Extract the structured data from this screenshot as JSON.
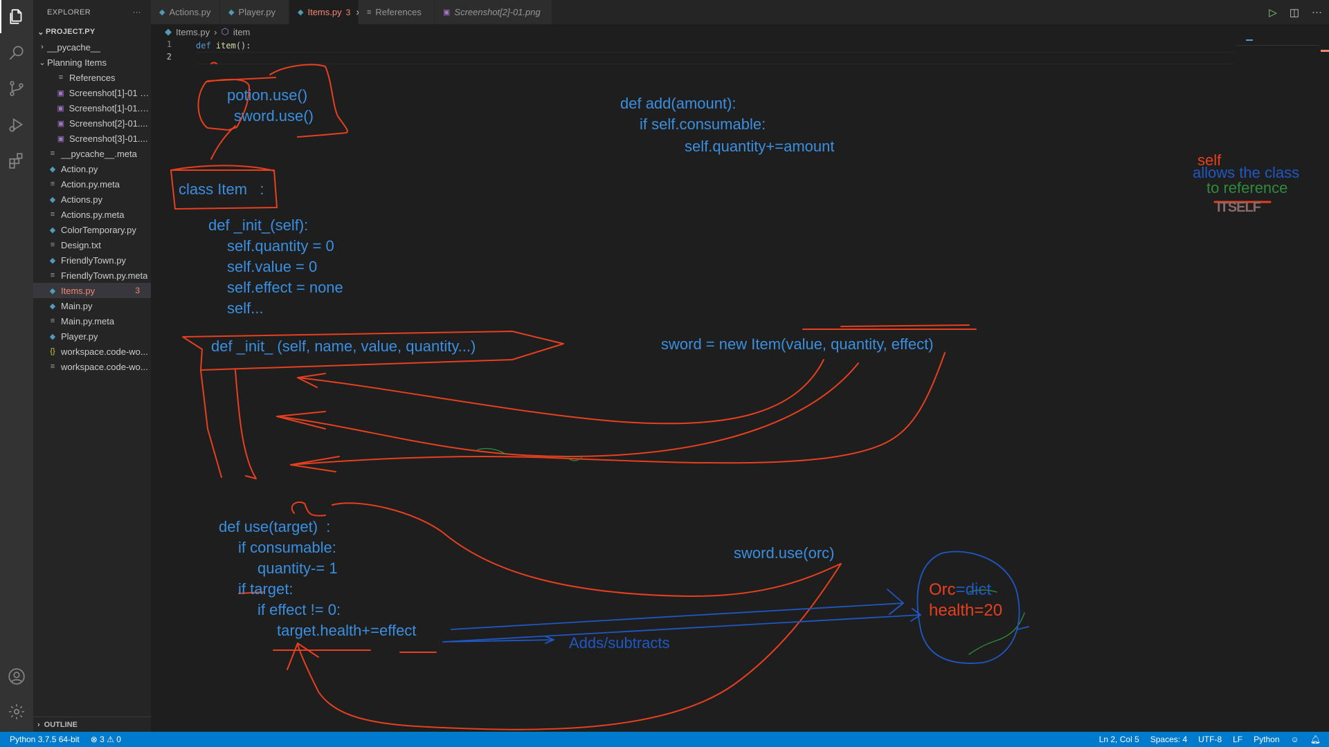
{
  "sidebar": {
    "title": "EXPLORER",
    "more": "···",
    "root": "PROJECT.PY",
    "items": [
      {
        "label": "__pycache__",
        "icon": "folder",
        "indent": 1,
        "chev": "›"
      },
      {
        "label": "Planning Items",
        "icon": "folder-open",
        "indent": 1,
        "chev": "⌄"
      },
      {
        "label": "References",
        "icon": "file-txt",
        "indent": 2
      },
      {
        "label": "Screenshot[1]-01 c...",
        "icon": "image",
        "indent": 2
      },
      {
        "label": "Screenshot[1]-01.p...",
        "icon": "image",
        "indent": 2
      },
      {
        "label": "Screenshot[2]-01....",
        "icon": "image",
        "indent": 2
      },
      {
        "label": "Screenshot[3]-01....",
        "icon": "image",
        "indent": 2
      },
      {
        "label": "__pycache__.meta",
        "icon": "file-txt",
        "indent": 1
      },
      {
        "label": "Action.py",
        "icon": "python",
        "indent": 1
      },
      {
        "label": "Action.py.meta",
        "icon": "file-txt",
        "indent": 1
      },
      {
        "label": "Actions.py",
        "icon": "python",
        "indent": 1
      },
      {
        "label": "Actions.py.meta",
        "icon": "file-txt",
        "indent": 1
      },
      {
        "label": "ColorTemporary.py",
        "icon": "python",
        "indent": 1
      },
      {
        "label": "Design.txt",
        "icon": "file-txt",
        "indent": 1
      },
      {
        "label": "FriendlyTown.py",
        "icon": "python",
        "indent": 1
      },
      {
        "label": "FriendlyTown.py.meta",
        "icon": "file-txt",
        "indent": 1
      },
      {
        "label": "Items.py",
        "icon": "python",
        "indent": 1,
        "selected": true,
        "badge": "3"
      },
      {
        "label": "Main.py",
        "icon": "python",
        "indent": 1
      },
      {
        "label": "Main.py.meta",
        "icon": "file-txt",
        "indent": 1
      },
      {
        "label": "Player.py",
        "icon": "python",
        "indent": 1
      },
      {
        "label": "workspace.code-wo...",
        "icon": "json",
        "indent": 1
      },
      {
        "label": "workspace.code-wo...",
        "icon": "file-txt",
        "indent": 1
      }
    ],
    "outline": "OUTLINE"
  },
  "tabs": [
    {
      "label": "Actions.py",
      "icon": "python"
    },
    {
      "label": "Player.py",
      "icon": "python"
    },
    {
      "label": "Items.py",
      "icon": "python",
      "active": true,
      "count": "3",
      "close": "×"
    },
    {
      "label": "References",
      "icon": "file-txt"
    },
    {
      "label": "Screenshot[2]-01.png",
      "icon": "image",
      "italic": true
    }
  ],
  "breadcrumb": {
    "file": "Items.py",
    "symbol": "item"
  },
  "editor": {
    "line_numbers": [
      "1",
      "2"
    ],
    "code_keyword": "def",
    "code_fn": "item",
    "code_rest": "():"
  },
  "ink": {
    "blue_texts": [
      {
        "text": "potion.use()"
      },
      {
        "text": "sword.use()"
      },
      {
        "text": "class Item   :"
      },
      {
        "text": "def _init_(self):"
      },
      {
        "text": "self.quantity = 0"
      },
      {
        "text": "self.value = 0"
      },
      {
        "text": "self.effect = none"
      },
      {
        "text": "self..."
      },
      {
        "text": "def _init_ (self, name, value, quantity...)"
      },
      {
        "text": "def use(target)  :"
      },
      {
        "text": "if consumable:"
      },
      {
        "text": "quantity-= 1"
      },
      {
        "text": "if target:"
      },
      {
        "text": "if effect != 0:"
      },
      {
        "text": "target.health+=effect"
      },
      {
        "text": "Adds/subtracts"
      },
      {
        "text": "def add(amount):"
      },
      {
        "text": "if self.consumable:"
      },
      {
        "text": "self.quantity+=amount"
      },
      {
        "text": "sword = new Item(value, quantity, effect)"
      },
      {
        "text": "sword.use(orc)"
      }
    ],
    "orc_label": "Orc",
    "orc_dict": "=dict",
    "orc_health": "health=20",
    "note_self": "self",
    "note_allows": "allows the class",
    "note_to": "to reference",
    "note_itself": "ITSELF",
    "colors": {
      "blue": "#3a8fe0",
      "red": "#e8401f",
      "green": "#2f8a3c",
      "darkblue": "#1f58c4"
    }
  },
  "status": {
    "interpreter": "Python 3.7.5 64-bit",
    "errors": "3",
    "warnings": "0",
    "position": "Ln 2, Col 5",
    "spaces": "Spaces: 4",
    "encoding": "UTF-8",
    "eol": "LF",
    "language": "Python"
  }
}
